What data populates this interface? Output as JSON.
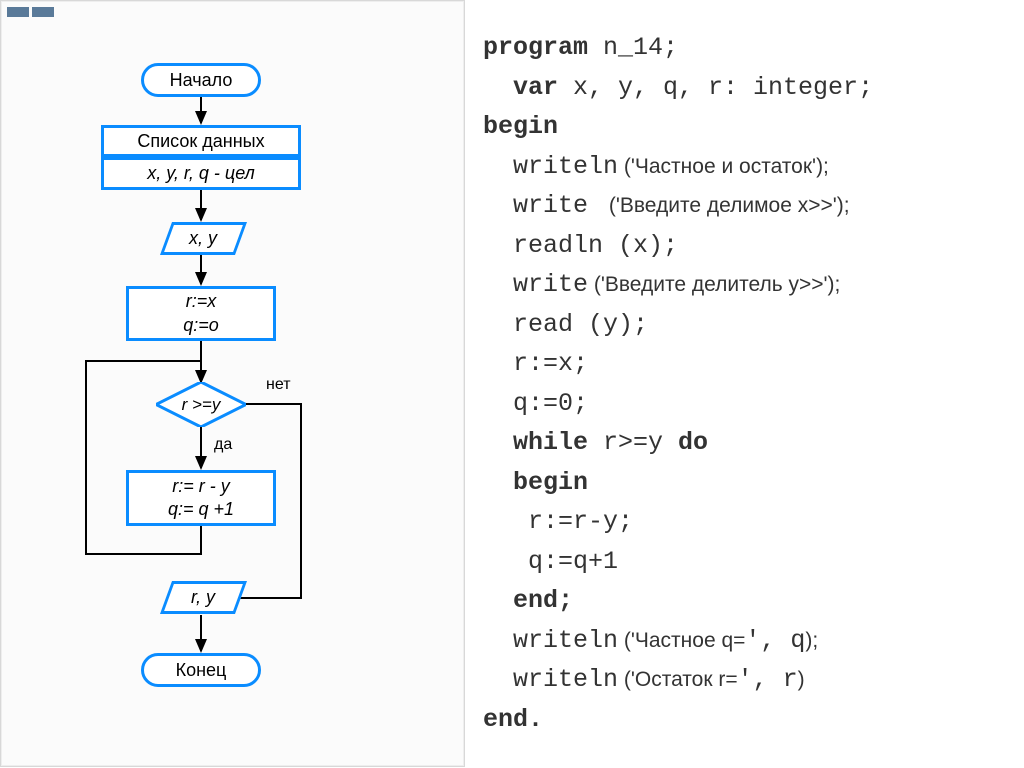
{
  "flowchart": {
    "start": "Начало",
    "data_header": "Список данных",
    "data_vars": "x, y, r, q - цел",
    "input": "x, y",
    "init_line1": "r:=x",
    "init_line2": "q:=o",
    "condition": "r >=y",
    "cond_yes": "да",
    "cond_no": "нет",
    "body_line1": "r:= r - y",
    "body_line2": "q:= q +1",
    "output": "r, y",
    "end": "Конец"
  },
  "code": {
    "l1a": "program",
    "l1b": " n_14;",
    "l2a": "  var",
    "l2b": " x, y, q, r: integer;",
    "l3": "begin",
    "l4a": "  writeln",
    "l4b": "'Частное и остаток'",
    "l4c": ");",
    "l5a": "  write ",
    "l5b": "'Введите делимое x>>'",
    "l5c": ");",
    "l6": "  readln (x);",
    "l7a": "  write",
    "l7b": "'Введите делитель y>>'",
    "l7c": ");",
    "l8": "  read (y);",
    "l9": "  r:=x;",
    "l10": "  q:=0;",
    "l11a": "  while",
    "l11b": " r>=y ",
    "l11c": "do",
    "l12": "  begin",
    "l13": "   r:=r-y;",
    "l14": "   q:=q+1",
    "l15": "  end;",
    "l16a": "  writeln",
    "l16b": "'Частное q=",
    "l16c": "', q",
    "l16d": ");",
    "l17a": "  writeln",
    "l17b": "'Остаток r=",
    "l17c": "', r",
    "l17d": ")",
    "l18": "end."
  }
}
